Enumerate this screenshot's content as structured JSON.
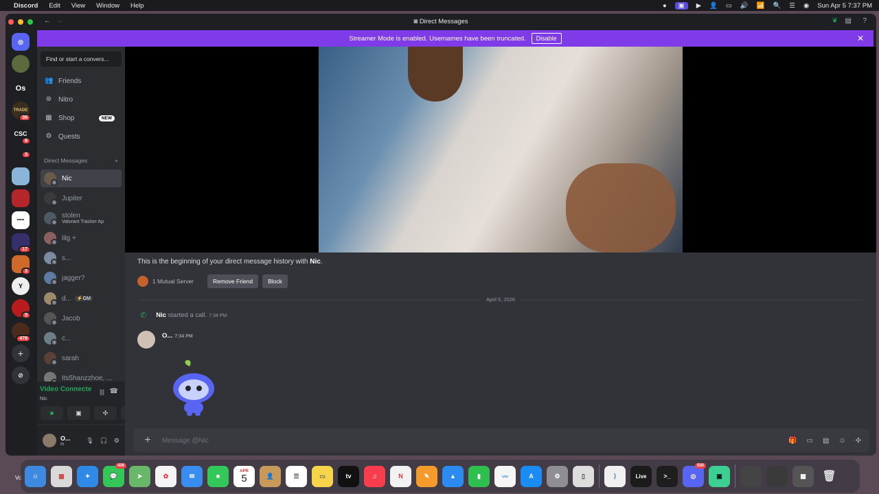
{
  "menubar": {
    "apple_icon": "apple-icon",
    "app_name": "Discord",
    "items": [
      "Edit",
      "View",
      "Window",
      "Help"
    ],
    "datetime": "Sun Apr 5  7:37 PM"
  },
  "window": {
    "title": "Direct Messages"
  },
  "banner": {
    "text": "Streamer Mode is enabled. Usernames have been truncated.",
    "button": "Disable"
  },
  "servers": [
    {
      "label": "",
      "badge": ""
    },
    {
      "label": "Os",
      "badge": ""
    },
    {
      "label": "TRADE",
      "badge": "36"
    },
    {
      "label": "CSC",
      "badge": "8"
    },
    {
      "label": "",
      "badge": "3"
    },
    {
      "label": "",
      "badge": ""
    },
    {
      "label": "",
      "badge": ""
    },
    {
      "label": "",
      "badge": ""
    },
    {
      "label": "",
      "badge": "17"
    },
    {
      "label": "",
      "badge": "3"
    },
    {
      "label": "",
      "badge": ""
    },
    {
      "label": "",
      "badge": "5"
    },
    {
      "label": "",
      "badge": "478"
    }
  ],
  "search": {
    "placeholder": "Find or start a convers..."
  },
  "nav": {
    "friends": "Friends",
    "nitro": "Nitro",
    "shop": "Shop",
    "shop_badge": "NEW",
    "quests": "Quests"
  },
  "dm_header": {
    "label": "Direct Messages",
    "add": "+"
  },
  "dms": [
    {
      "name": "Nic",
      "sub": "",
      "tag": "",
      "color": "#6b5a48"
    },
    {
      "name": "Jupiter",
      "sub": "",
      "tag": "",
      "color": "#3a3a3a"
    },
    {
      "name": "stolen",
      "sub": "Valorant Tracker Ap",
      "tag": "",
      "color": "#4d5a66"
    },
    {
      "name": "lilg +",
      "sub": "",
      "tag": "",
      "color": "#8a5f5f"
    },
    {
      "name": "s...",
      "sub": "",
      "tag": "",
      "color": "#7c8ca0"
    },
    {
      "name": "jagger?",
      "sub": "",
      "tag": "",
      "color": "#5d7aa2"
    },
    {
      "name": "d...",
      "sub": "",
      "tag": "⚡GM",
      "color": "#9c8a6a"
    },
    {
      "name": "Jacob",
      "sub": "",
      "tag": "",
      "color": "#555555"
    },
    {
      "name": "c...",
      "sub": "",
      "tag": "",
      "color": "#6c7f88"
    },
    {
      "name": "sarah",
      "sub": "",
      "tag": "",
      "color": "#5a4038"
    },
    {
      "name": "Its5hanzzhoe, ...",
      "sub": "",
      "tag": "",
      "color": "#777777"
    }
  ],
  "voice": {
    "title": "Video Connecte",
    "subtitle": "Nic"
  },
  "user": {
    "name": "O...",
    "status": "In"
  },
  "chat": {
    "intro_prefix": "This is the beginning of your direct message history with ",
    "intro_name": "Nic",
    "intro_suffix": ".",
    "mutual": "1 Mutual Server",
    "remove_friend": "Remove Friend",
    "block": "Block",
    "date_divider": "April 5, 2026",
    "call_name": "Nic",
    "call_text": " started a call.",
    "call_time": "7:34 PM",
    "msg_author": "O...",
    "msg_time": "7:34 PM"
  },
  "composer": {
    "placeholder": "Message @Nic"
  },
  "dock": {
    "calendar_month": "APR",
    "calendar_day": "5",
    "messages_badge": "426",
    "discord_badge": "550",
    "tv_label": "tv",
    "live_label": "Live",
    "vo_label": "Vo"
  }
}
